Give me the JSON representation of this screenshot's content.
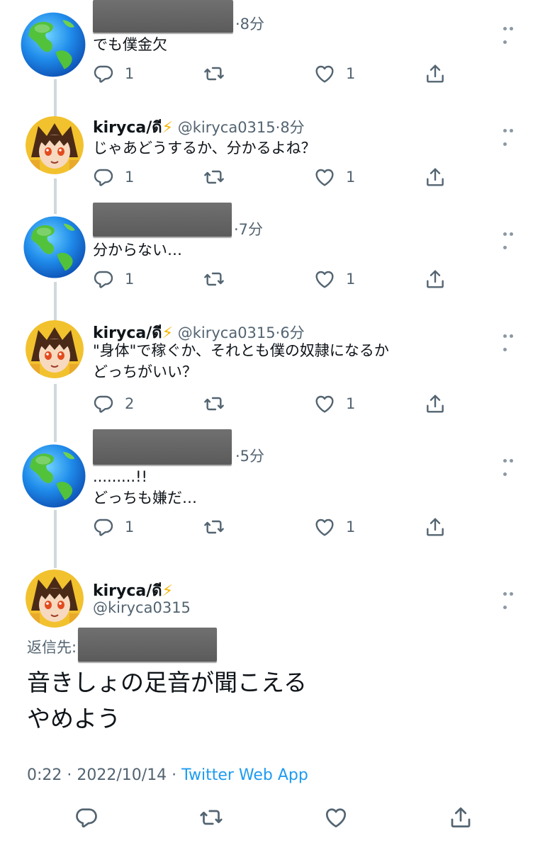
{
  "tweets": [
    {
      "kind": "other",
      "time": "·8分",
      "text": "でも僕金欠",
      "replies": "1",
      "likes": "1"
    },
    {
      "kind": "kiryca",
      "name": "kiryca/ดี",
      "handle": "@kiryca0315",
      "time": "·8分",
      "text": "じゃあどうするか、分かるよね？",
      "replies": "1",
      "likes": "1"
    },
    {
      "kind": "other",
      "time": "·7分",
      "text": "分からない…",
      "replies": "1",
      "likes": "1"
    },
    {
      "kind": "kiryca",
      "name": "kiryca/ดี",
      "handle": "@kiryca0315",
      "time": "·6分",
      "text": "\"身体\"で稼ぐか、それとも僕の奴隷になるか\nどっちがいい？",
      "replies": "2",
      "likes": "1"
    },
    {
      "kind": "other",
      "time": "·5分",
      "text": ".........!!\nどっちも嫌だ…",
      "replies": "1",
      "likes": "1"
    }
  ],
  "main_tweet": {
    "name": "kiryca/ดี",
    "handle": "@kiryca0315",
    "reply_to_label": "返信先:",
    "text": "音きしょの足音が聞こえる\nやめよう",
    "time": "0:22 · 2022/10/14 · ",
    "app": "Twitter Web App"
  },
  "icons": {
    "reply": "reply-icon",
    "retweet": "retweet-icon",
    "like": "like-icon",
    "share": "share-icon",
    "more": "more-icon",
    "globe": "globe-avatar",
    "bolt": "lightning-emoji"
  },
  "colors": {
    "link": "#1d9bf0",
    "secondary": "#536471",
    "thread_line": "#cfd9de",
    "bolt": "#f7b500"
  }
}
